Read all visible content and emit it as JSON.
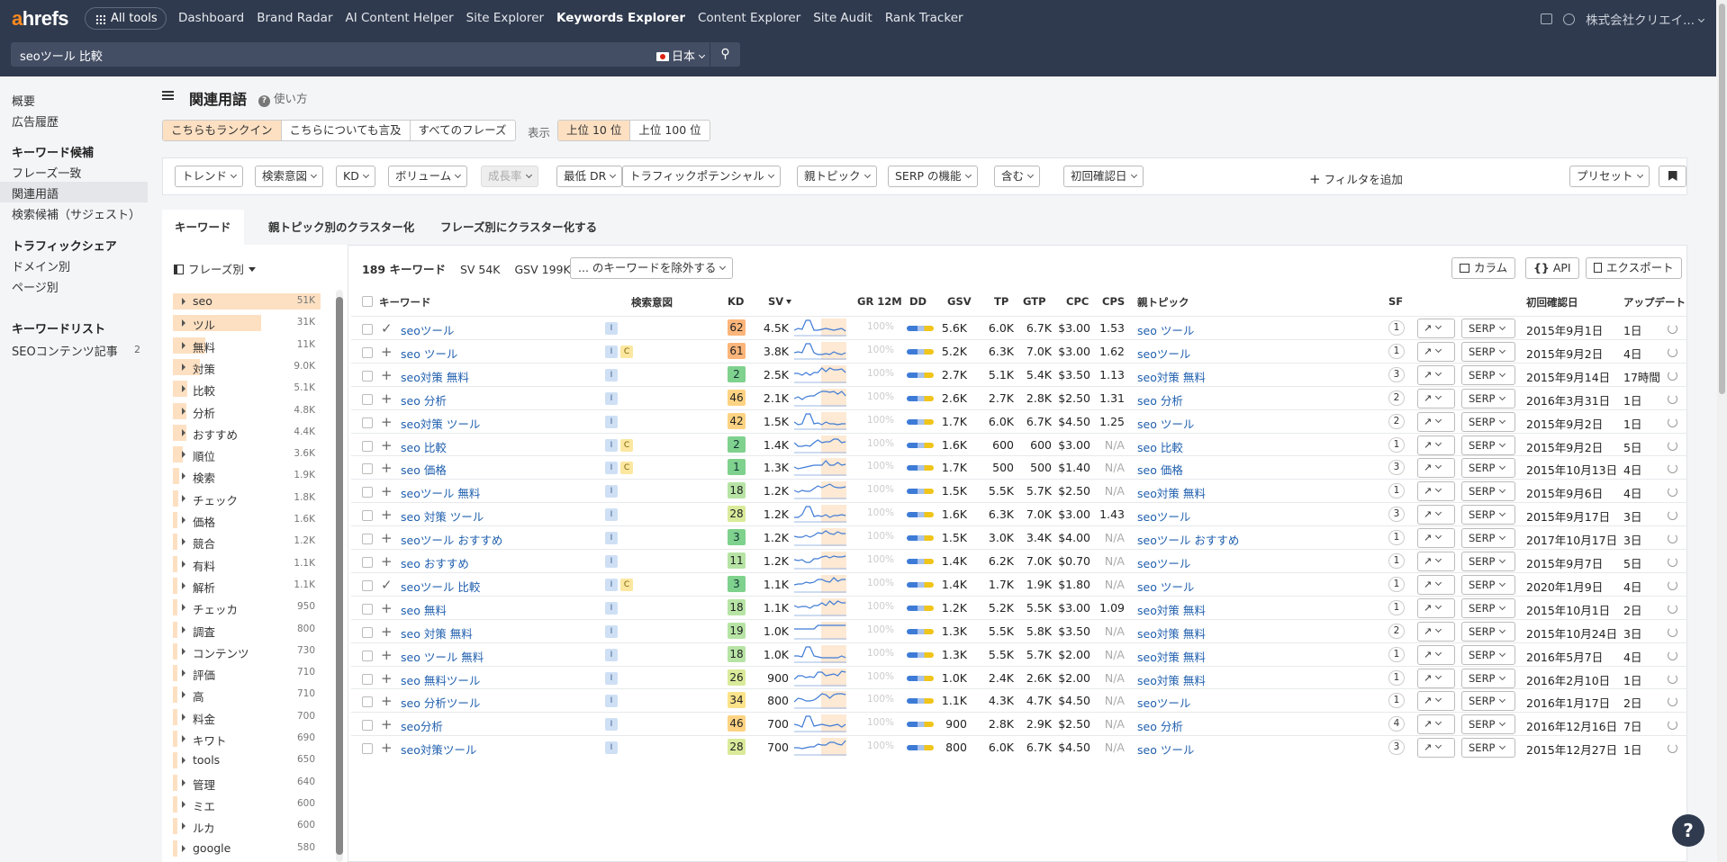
{
  "topbar": {
    "logo": "ahrefs",
    "all_tools": "All tools",
    "nav": [
      "Dashboard",
      "Brand Radar",
      "AI Content Helper",
      "Site Explorer",
      "Keywords Explorer",
      "Content Explorer",
      "Site Audit",
      "Rank Tracker"
    ],
    "active_nav": "Keywords Explorer",
    "account": "株式会社クリエイ..."
  },
  "search": {
    "query": "seoツール 比較",
    "country": "日本"
  },
  "sidebar": {
    "overview": "概要",
    "ad_history": "広告履歴",
    "kw_ideas_heading": "キーワード候補",
    "phrase_match": "フレーズ一致",
    "related_terms": "関連用語",
    "search_suggestions": "検索候補（サジェスト）",
    "traffic_share_heading": "トラフィックシェア",
    "by_domain": "ドメイン別",
    "by_page": "ページ別",
    "kw_lists_heading": "キーワードリスト",
    "list_item": "SEOコンテンツ記事",
    "list_count": "2"
  },
  "page": {
    "title": "関連用語",
    "howto": "使い方",
    "rank_modes": [
      "こちらもランクイン",
      "こちらについても言及",
      "すべてのフレーズ"
    ],
    "display_label": "表示",
    "top_modes": [
      "上位 10 位",
      "上位 100 位"
    ]
  },
  "filters": {
    "items": [
      "トレンド",
      "検索意図",
      "KD",
      "ボリューム",
      "成長率",
      "最低 DR",
      "トラフィックポテンシャル",
      "親トピック",
      "SERP の機能",
      "含む",
      "初回確認日"
    ],
    "add_filter": "フィルタを追加",
    "preset": "プリセット"
  },
  "tabs": [
    "キーワード",
    "親トピック別のクラスター化",
    "フレーズ別にクラスター化する"
  ],
  "phrases": {
    "header": "フレーズ別",
    "items": [
      {
        "label": "seo",
        "count": "51K",
        "fill": 1.0
      },
      {
        "label": "ツル",
        "count": "31K",
        "fill": 0.6
      },
      {
        "label": "無料",
        "count": "11K",
        "fill": 0.22
      },
      {
        "label": "対策",
        "count": "9.0K",
        "fill": 0.18
      },
      {
        "label": "比較",
        "count": "5.1K",
        "fill": 0.1
      },
      {
        "label": "分析",
        "count": "4.8K",
        "fill": 0.09
      },
      {
        "label": "おすすめ",
        "count": "4.4K",
        "fill": 0.09
      },
      {
        "label": "順位",
        "count": "3.6K",
        "fill": 0.07
      },
      {
        "label": "検索",
        "count": "1.9K",
        "fill": 0.04
      },
      {
        "label": "チェック",
        "count": "1.8K",
        "fill": 0.035
      },
      {
        "label": "価格",
        "count": "1.6K",
        "fill": 0.03
      },
      {
        "label": "競合",
        "count": "1.2K",
        "fill": 0.025
      },
      {
        "label": "有料",
        "count": "1.1K",
        "fill": 0.02
      },
      {
        "label": "解析",
        "count": "1.1K",
        "fill": 0.02
      },
      {
        "label": "チェッカ",
        "count": "950",
        "fill": 0.02
      },
      {
        "label": "調査",
        "count": "800",
        "fill": 0.015
      },
      {
        "label": "コンテンツ",
        "count": "730",
        "fill": 0.015
      },
      {
        "label": "評価",
        "count": "710",
        "fill": 0.015
      },
      {
        "label": "高",
        "count": "710",
        "fill": 0.015
      },
      {
        "label": "料金",
        "count": "700",
        "fill": 0.015
      },
      {
        "label": "キワト",
        "count": "690",
        "fill": 0.015
      },
      {
        "label": "tools",
        "count": "650",
        "fill": 0.013
      },
      {
        "label": "管理",
        "count": "640",
        "fill": 0.013
      },
      {
        "label": "ミエ",
        "count": "600",
        "fill": 0.012
      },
      {
        "label": "ルカ",
        "count": "600",
        "fill": 0.012
      },
      {
        "label": "google",
        "count": "580",
        "fill": 0.012
      }
    ]
  },
  "table_toolbar": {
    "kw_count": "189 キーワード",
    "sv": "SV 54K",
    "gsv": "GSV 199K",
    "exclude": "... のキーワードを除外する",
    "columns": "カラム",
    "api": "API",
    "export": "エクスポート"
  },
  "columns": [
    "キーワード",
    "検索意図",
    "KD",
    "SV",
    "GR 12M",
    "DD",
    "GSV",
    "TP",
    "GTP",
    "CPC",
    "CPS",
    "親トピック",
    "SF",
    "初回確認日",
    "アップデート"
  ],
  "rows": [
    {
      "kw": "seoツール",
      "check": true,
      "intent": [
        "I"
      ],
      "kd": "62",
      "sv": "4.5K",
      "gr": "100%",
      "gsv": "5.6K",
      "tp": "6.0K",
      "gtp": "6.7K",
      "cpc": "$3.00",
      "cps": "1.53",
      "parent": "seo ツール",
      "sf": "1",
      "first": "2015年9月1日",
      "upd": "1日"
    },
    {
      "kw": "seo ツール",
      "check": false,
      "intent": [
        "I",
        "C"
      ],
      "kd": "61",
      "sv": "3.8K",
      "gr": "100%",
      "gsv": "5.2K",
      "tp": "6.3K",
      "gtp": "7.0K",
      "cpc": "$3.00",
      "cps": "1.62",
      "parent": "seoツール",
      "sf": "1",
      "first": "2015年9月2日",
      "upd": "4日"
    },
    {
      "kw": "seo対策 無料",
      "check": false,
      "intent": [
        "I"
      ],
      "kd": "2",
      "sv": "2.5K",
      "gr": "100%",
      "gsv": "2.7K",
      "tp": "5.1K",
      "gtp": "5.4K",
      "cpc": "$3.50",
      "cps": "1.13",
      "parent": "seo対策 無料",
      "sf": "3",
      "first": "2015年9月14日",
      "upd": "17時間"
    },
    {
      "kw": "seo 分析",
      "check": false,
      "intent": [
        "I"
      ],
      "kd": "46",
      "sv": "2.1K",
      "gr": "100%",
      "gsv": "2.6K",
      "tp": "2.7K",
      "gtp": "2.8K",
      "cpc": "$2.50",
      "cps": "1.31",
      "parent": "seo 分析",
      "sf": "2",
      "first": "2016年3月31日",
      "upd": "1日"
    },
    {
      "kw": "seo対策 ツール",
      "check": false,
      "intent": [
        "I"
      ],
      "kd": "42",
      "sv": "1.5K",
      "gr": "100%",
      "gsv": "1.7K",
      "tp": "6.0K",
      "gtp": "6.7K",
      "cpc": "$4.50",
      "cps": "1.25",
      "parent": "seo ツール",
      "sf": "2",
      "first": "2015年9月2日",
      "upd": "1日"
    },
    {
      "kw": "seo 比較",
      "check": false,
      "intent": [
        "I",
        "C"
      ],
      "kd": "2",
      "sv": "1.4K",
      "gr": "100%",
      "gsv": "1.6K",
      "tp": "600",
      "gtp": "600",
      "cpc": "$3.00",
      "cps": "N/A",
      "parent": "seo 比較",
      "sf": "1",
      "first": "2015年9月2日",
      "upd": "5日"
    },
    {
      "kw": "seo 価格",
      "check": false,
      "intent": [
        "I",
        "C"
      ],
      "kd": "1",
      "sv": "1.3K",
      "gr": "100%",
      "gsv": "1.7K",
      "tp": "500",
      "gtp": "500",
      "cpc": "$1.40",
      "cps": "N/A",
      "parent": "seo 価格",
      "sf": "3",
      "first": "2015年10月13日",
      "upd": "4日"
    },
    {
      "kw": "seoツール 無料",
      "check": false,
      "intent": [
        "I"
      ],
      "kd": "18",
      "sv": "1.2K",
      "gr": "100%",
      "gsv": "1.5K",
      "tp": "5.5K",
      "gtp": "5.7K",
      "cpc": "$2.50",
      "cps": "N/A",
      "parent": "seo対策 無料",
      "sf": "1",
      "first": "2015年9月6日",
      "upd": "4日"
    },
    {
      "kw": "seo 対策 ツール",
      "check": false,
      "intent": [
        "I"
      ],
      "kd": "28",
      "sv": "1.2K",
      "gr": "100%",
      "gsv": "1.6K",
      "tp": "6.3K",
      "gtp": "7.0K",
      "cpc": "$3.00",
      "cps": "1.43",
      "parent": "seoツール",
      "sf": "3",
      "first": "2015年9月17日",
      "upd": "3日"
    },
    {
      "kw": "seoツール おすすめ",
      "check": false,
      "intent": [
        "I"
      ],
      "kd": "3",
      "sv": "1.2K",
      "gr": "100%",
      "gsv": "1.5K",
      "tp": "3.0K",
      "gtp": "3.4K",
      "cpc": "$4.00",
      "cps": "N/A",
      "parent": "seoツール おすすめ",
      "sf": "1",
      "first": "2017年10月17日",
      "upd": "3日"
    },
    {
      "kw": "seo おすすめ",
      "check": false,
      "intent": [
        "I"
      ],
      "kd": "11",
      "sv": "1.2K",
      "gr": "100%",
      "gsv": "1.4K",
      "tp": "6.2K",
      "gtp": "7.0K",
      "cpc": "$0.70",
      "cps": "N/A",
      "parent": "seoツール",
      "sf": "1",
      "first": "2015年9月7日",
      "upd": "5日"
    },
    {
      "kw": "seoツール 比較",
      "check": true,
      "intent": [
        "I",
        "C"
      ],
      "kd": "3",
      "sv": "1.1K",
      "gr": "100%",
      "gsv": "1.4K",
      "tp": "1.7K",
      "gtp": "1.9K",
      "cpc": "$1.80",
      "cps": "N/A",
      "parent": "seo ツール",
      "sf": "1",
      "first": "2020年1月9日",
      "upd": "4日"
    },
    {
      "kw": "seo 無料",
      "check": false,
      "intent": [
        "I"
      ],
      "kd": "18",
      "sv": "1.1K",
      "gr": "100%",
      "gsv": "1.2K",
      "tp": "5.2K",
      "gtp": "5.5K",
      "cpc": "$3.00",
      "cps": "1.09",
      "parent": "seo対策 無料",
      "sf": "1",
      "first": "2015年10月1日",
      "upd": "2日"
    },
    {
      "kw": "seo 対策 無料",
      "check": false,
      "intent": [
        "I"
      ],
      "kd": "19",
      "sv": "1.0K",
      "gr": "100%",
      "gsv": "1.3K",
      "tp": "5.5K",
      "gtp": "5.8K",
      "cpc": "$3.50",
      "cps": "N/A",
      "parent": "seo対策 無料",
      "sf": "2",
      "first": "2015年10月24日",
      "upd": "3日"
    },
    {
      "kw": "seo ツール 無料",
      "check": false,
      "intent": [
        "I"
      ],
      "kd": "18",
      "sv": "1.0K",
      "gr": "100%",
      "gsv": "1.3K",
      "tp": "5.5K",
      "gtp": "5.7K",
      "cpc": "$2.00",
      "cps": "N/A",
      "parent": "seo対策 無料",
      "sf": "1",
      "first": "2016年5月7日",
      "upd": "4日"
    },
    {
      "kw": "seo 無料ツール",
      "check": false,
      "intent": [
        "I"
      ],
      "kd": "26",
      "sv": "900",
      "gr": "100%",
      "gsv": "1.0K",
      "tp": "2.4K",
      "gtp": "2.6K",
      "cpc": "$2.00",
      "cps": "N/A",
      "parent": "seo対策 無料",
      "sf": "1",
      "first": "2016年2月10日",
      "upd": "1日"
    },
    {
      "kw": "seo 分析ツール",
      "check": false,
      "intent": [
        "I"
      ],
      "kd": "34",
      "sv": "800",
      "gr": "100%",
      "gsv": "1.1K",
      "tp": "4.3K",
      "gtp": "4.7K",
      "cpc": "$4.50",
      "cps": "N/A",
      "parent": "seoツール",
      "sf": "1",
      "first": "2016年1月17日",
      "upd": "2日"
    },
    {
      "kw": "seo分析",
      "check": false,
      "intent": [
        "I"
      ],
      "kd": "46",
      "sv": "700",
      "gr": "100%",
      "gsv": "900",
      "tp": "2.8K",
      "gtp": "2.9K",
      "cpc": "$2.50",
      "cps": "N/A",
      "parent": "seo 分析",
      "sf": "4",
      "first": "2016年12月16日",
      "upd": "7日"
    },
    {
      "kw": "seo対策ツール",
      "check": false,
      "intent": [
        "I"
      ],
      "kd": "28",
      "sv": "700",
      "gr": "100%",
      "gsv": "800",
      "tp": "6.0K",
      "gtp": "6.7K",
      "cpc": "$4.50",
      "cps": "N/A",
      "parent": "seo ツール",
      "sf": "3",
      "first": "2015年12月27日",
      "upd": "1日"
    }
  ],
  "serp_label": "SERP",
  "colors": {
    "accent": "#ff8b1f",
    "topbar": "#2f3a4e",
    "link": "#1f5fae",
    "selected_bg": "#fde0c2"
  }
}
